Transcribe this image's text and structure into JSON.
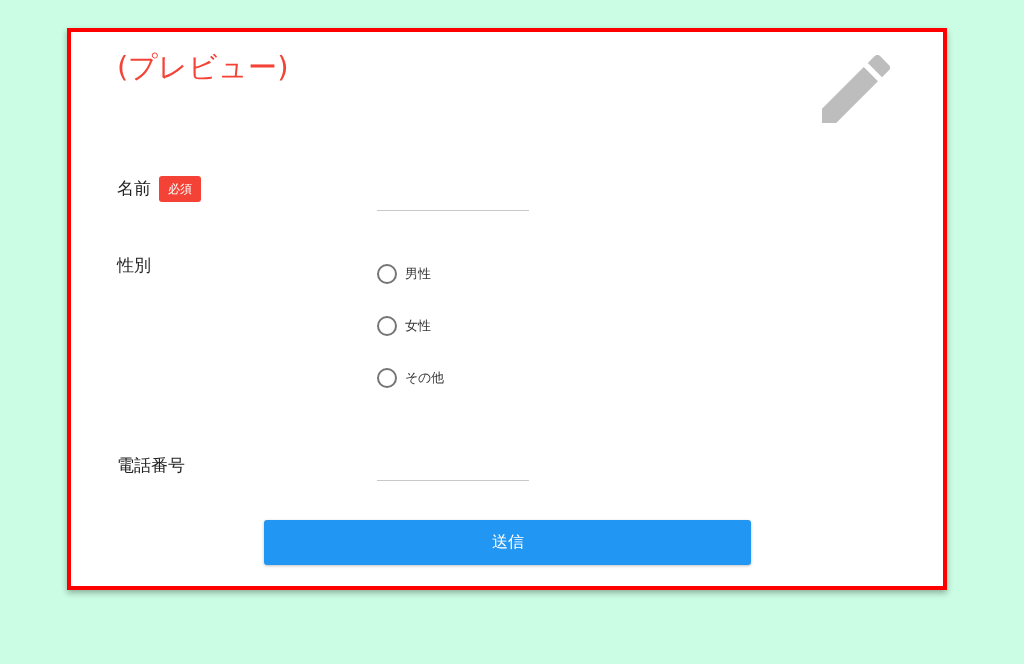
{
  "title": "(プレビュー)",
  "fields": [
    {
      "kind": "text",
      "label": "名前",
      "badge": "必須"
    },
    {
      "kind": "radio",
      "label": "性別",
      "options": [
        {
          "label": "男性",
          "selected": false
        },
        {
          "label": "女性",
          "selected": false
        },
        {
          "label": "その他",
          "selected": false
        }
      ]
    },
    {
      "kind": "text",
      "label": "電話番号"
    }
  ],
  "submit": "送信"
}
